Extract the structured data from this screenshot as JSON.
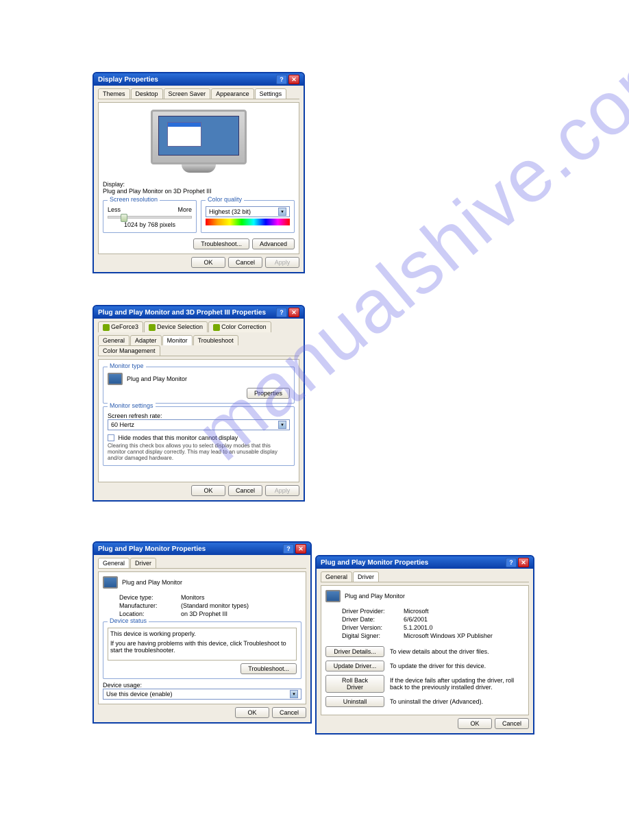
{
  "watermark": "manualshive.com",
  "dlg1": {
    "title": "Display Properties",
    "tabs": [
      "Themes",
      "Desktop",
      "Screen Saver",
      "Appearance",
      "Settings"
    ],
    "display_label": "Display:",
    "display_value": "Plug and Play Monitor on 3D Prophet III",
    "resolution_group": "Screen resolution",
    "less": "Less",
    "more": "More",
    "resolution_value": "1024 by 768 pixels",
    "quality_group": "Color quality",
    "quality_value": "Highest (32 bit)",
    "troubleshoot": "Troubleshoot...",
    "advanced": "Advanced",
    "ok": "OK",
    "cancel": "Cancel",
    "apply": "Apply"
  },
  "dlg2": {
    "title": "Plug and Play Monitor and 3D Prophet III Properties",
    "top_tabs": [
      "GeForce3",
      "Device Selection",
      "Color Correction"
    ],
    "tabs": [
      "General",
      "Adapter",
      "Monitor",
      "Troubleshoot",
      "Color Management"
    ],
    "monitor_type_group": "Monitor type",
    "monitor_name": "Plug and Play Monitor",
    "properties": "Properties",
    "settings_group": "Monitor settings",
    "refresh_label": "Screen refresh rate:",
    "refresh_value": "60 Hertz",
    "hide_label": "Hide modes that this monitor cannot display",
    "hide_desc": "Clearing this check box allows you to select display modes that this monitor cannot display correctly. This may lead to an unusable display and/or damaged hardware.",
    "ok": "OK",
    "cancel": "Cancel",
    "apply": "Apply"
  },
  "dlg3": {
    "title": "Plug and Play Monitor Properties",
    "tabs": [
      "General",
      "Driver"
    ],
    "device_name": "Plug and Play Monitor",
    "device_type_lbl": "Device type:",
    "device_type": "Monitors",
    "manufacturer_lbl": "Manufacturer:",
    "manufacturer": "(Standard monitor types)",
    "location_lbl": "Location:",
    "location": "on 3D Prophet III",
    "status_group": "Device status",
    "status_text": "This device is working properly.",
    "status_help": "If you are having problems with this device, click Troubleshoot to start the troubleshooter.",
    "troubleshoot": "Troubleshoot...",
    "usage_lbl": "Device usage:",
    "usage_value": "Use this device (enable)",
    "ok": "OK",
    "cancel": "Cancel"
  },
  "dlg4": {
    "title": "Plug and Play Monitor Properties",
    "tabs": [
      "General",
      "Driver"
    ],
    "device_name": "Plug and Play Monitor",
    "provider_lbl": "Driver Provider:",
    "provider": "Microsoft",
    "date_lbl": "Driver Date:",
    "date": "6/6/2001",
    "version_lbl": "Driver Version:",
    "version": "5.1.2001.0",
    "signer_lbl": "Digital Signer:",
    "signer": "Microsoft Windows XP Publisher",
    "details_btn": "Driver Details...",
    "details_desc": "To view details about the driver files.",
    "update_btn": "Update Driver...",
    "update_desc": "To update the driver for this device.",
    "rollback_btn": "Roll Back Driver",
    "rollback_desc": "If the device fails after updating the driver, roll back to the previously installed driver.",
    "uninstall_btn": "Uninstall",
    "uninstall_desc": "To uninstall the driver (Advanced).",
    "ok": "OK",
    "cancel": "Cancel"
  }
}
